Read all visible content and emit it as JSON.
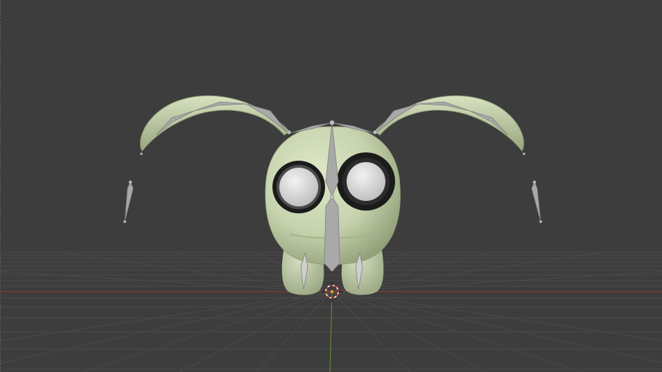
{
  "viewport": {
    "background_color": "#3d3d3d",
    "grid_color": "#4a4a4a",
    "x_axis_color": "#8a3a3a",
    "y_axis_color": "#5f8a34",
    "shading": "solid"
  },
  "scene": {
    "object": "creature-mesh",
    "body_color": "#c9d6b1",
    "armature_color": "#a9a9a9",
    "eye_ring_color": "#1b1b1b",
    "eye_color": "#e6e6e6",
    "cursor": "3d-cursor-icon"
  }
}
